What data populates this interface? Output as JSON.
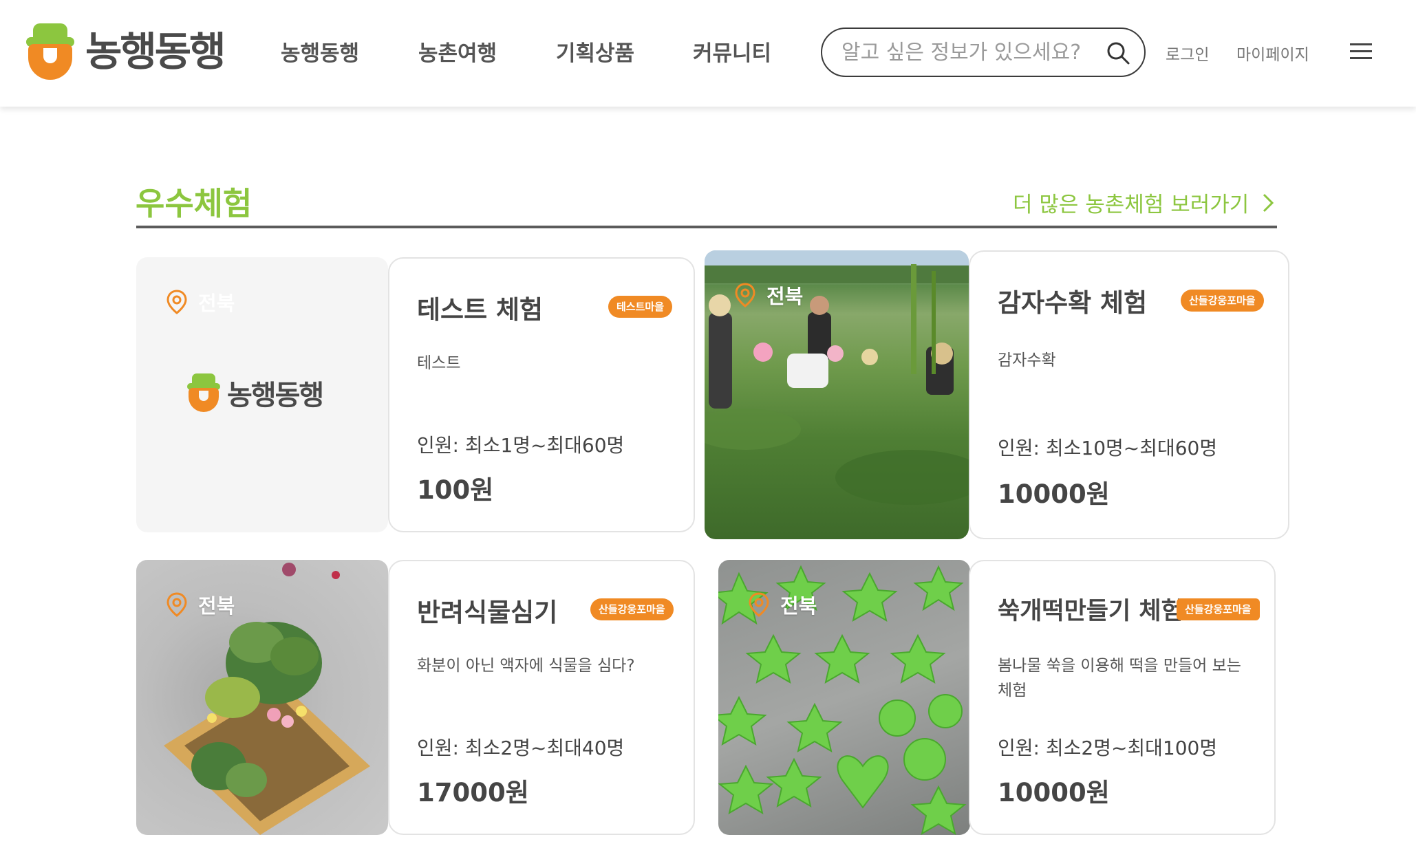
{
  "header": {
    "logo_text": "농행동행",
    "nav": [
      "농행동행",
      "농촌여행",
      "기획상품",
      "커뮤니티"
    ],
    "search_placeholder": "알고 싶은 정보가 있으세요?",
    "login": "로그인",
    "mypage": "마이페이지"
  },
  "section": {
    "title": "우수체험",
    "more_link": "더 많은 농촌체험 보러가기"
  },
  "cards": [
    {
      "location": "전북",
      "title": "테스트 체험",
      "badge": "테스트마을",
      "description": "테스트",
      "people": "인원:  최소1명~최대60명",
      "price": "100원",
      "thumb_logo": "농행동행"
    },
    {
      "location": "전북",
      "title": "감자수확 체험",
      "badge": "산들강웅포마을",
      "description": "감자수확",
      "people": "인원:  최소10명~최대60명",
      "price": "10000원"
    },
    {
      "location": "전북",
      "title": "반려식물심기",
      "badge": "산들강웅포마을",
      "description": "화분이 아닌 액자에 식물을 심다?",
      "people": "인원:  최소2명~최대40명",
      "price": "17000원"
    },
    {
      "location": "전북",
      "title": "쑥개떡만들기 체험",
      "badge": "산들강웅포마을",
      "description": "봄나물 쑥을 이용해 떡을 만들어 보는 체험",
      "people": "인원:  최소2명~최대100명",
      "price": "10000원"
    }
  ],
  "colors": {
    "brand_green": "#8cc63f",
    "brand_orange": "#f08a24"
  }
}
